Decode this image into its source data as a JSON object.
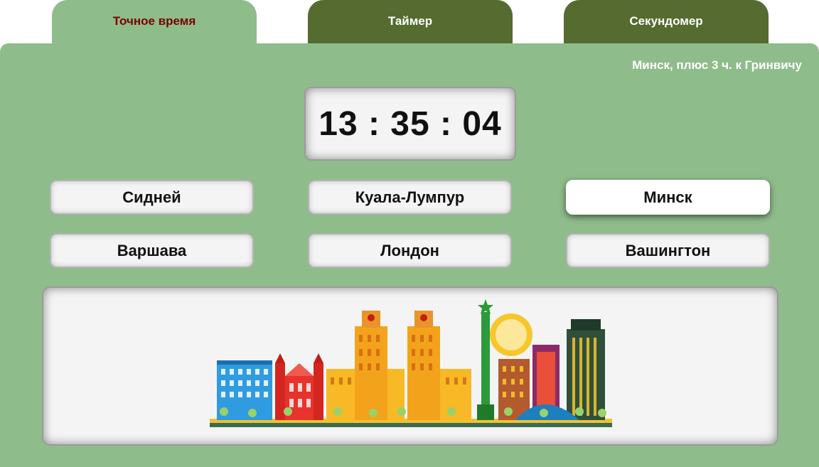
{
  "tabs": [
    {
      "label": "Точное время",
      "active": true
    },
    {
      "label": "Таймер",
      "active": false
    },
    {
      "label": "Секундомер",
      "active": false
    }
  ],
  "timezone_label": "Минск, плюс 3 ч. к Гринвичу",
  "clock": {
    "display": "13 : 35 : 04"
  },
  "cities": [
    {
      "label": "Сидней",
      "selected": false
    },
    {
      "label": "Куала-Лумпур",
      "selected": false
    },
    {
      "label": "Минск",
      "selected": true
    },
    {
      "label": "Варшава",
      "selected": false
    },
    {
      "label": "Лондон",
      "selected": false
    },
    {
      "label": "Вашингтон",
      "selected": false
    }
  ],
  "colors": {
    "panel": "#8fbc8b",
    "inactive_tab": "#556b2f",
    "active_tab_text": "#7a0000"
  },
  "illustration": {
    "icon": "minsk-skyline-illustration"
  }
}
